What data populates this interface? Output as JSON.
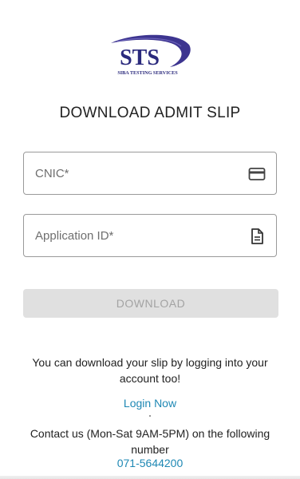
{
  "logo": {
    "name": "sts-logo",
    "text": "STS",
    "subtitle": "SIBA TESTING SERVICES",
    "colors": {
      "primary": "#2b2a7d",
      "swoosh": "#4a3f96"
    }
  },
  "page": {
    "title": "DOWNLOAD ADMIT SLIP"
  },
  "form": {
    "cnic": {
      "placeholder": "CNIC*",
      "value": "",
      "icon": "credit-card-icon"
    },
    "application_id": {
      "placeholder": "Application ID*",
      "value": "",
      "icon": "document-icon"
    },
    "download_button": "DOWNLOAD"
  },
  "info": {
    "login_text": "You can download your slip by logging into your account too!",
    "login_link": "Login Now",
    "contact_text": "Contact us (Mon-Sat 9AM-5PM) on the following number",
    "phone": "071-5644200"
  },
  "colors": {
    "link": "#1e88b4",
    "button_bg": "#e0e0e0",
    "button_text": "#a3a3a3",
    "border": "#9a9a9a"
  }
}
